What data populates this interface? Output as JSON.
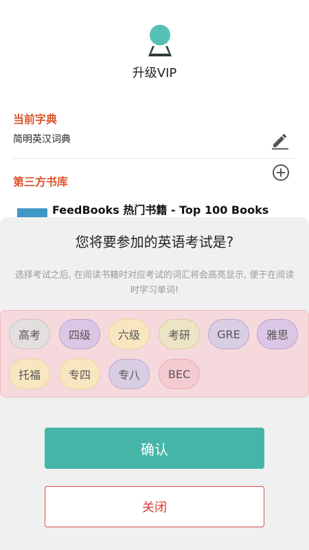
{
  "header": {
    "avatar_icon": "user-avatar-icon",
    "vip_label": "升级VIP"
  },
  "dictionary": {
    "section_title": "当前字典",
    "current_name": "简明英汉词典",
    "edit_icon": "pencil-icon"
  },
  "library": {
    "section_title": "第三方书库",
    "add_icon": "plus-circle-icon",
    "books": [
      {
        "title": "FeedBooks 热门书籍 - Top 100 Books"
      }
    ]
  },
  "exam_sheet": {
    "title": "您将要参加的英语考试是?",
    "description": "选择考试之后, 在阅读书籍时对应考试的词汇将会高亮显示, 便于在阅读时学习单词!",
    "options": [
      "高考",
      "四级",
      "六级",
      "考研",
      "GRE",
      "雅思",
      "托福",
      "专四",
      "专八",
      "BEC"
    ],
    "confirm_label": "确认",
    "close_label": "关闭"
  },
  "colors": {
    "accent_orange": "#d9552b",
    "confirm_teal": "#45b5a8",
    "close_red": "#d83a3a"
  }
}
